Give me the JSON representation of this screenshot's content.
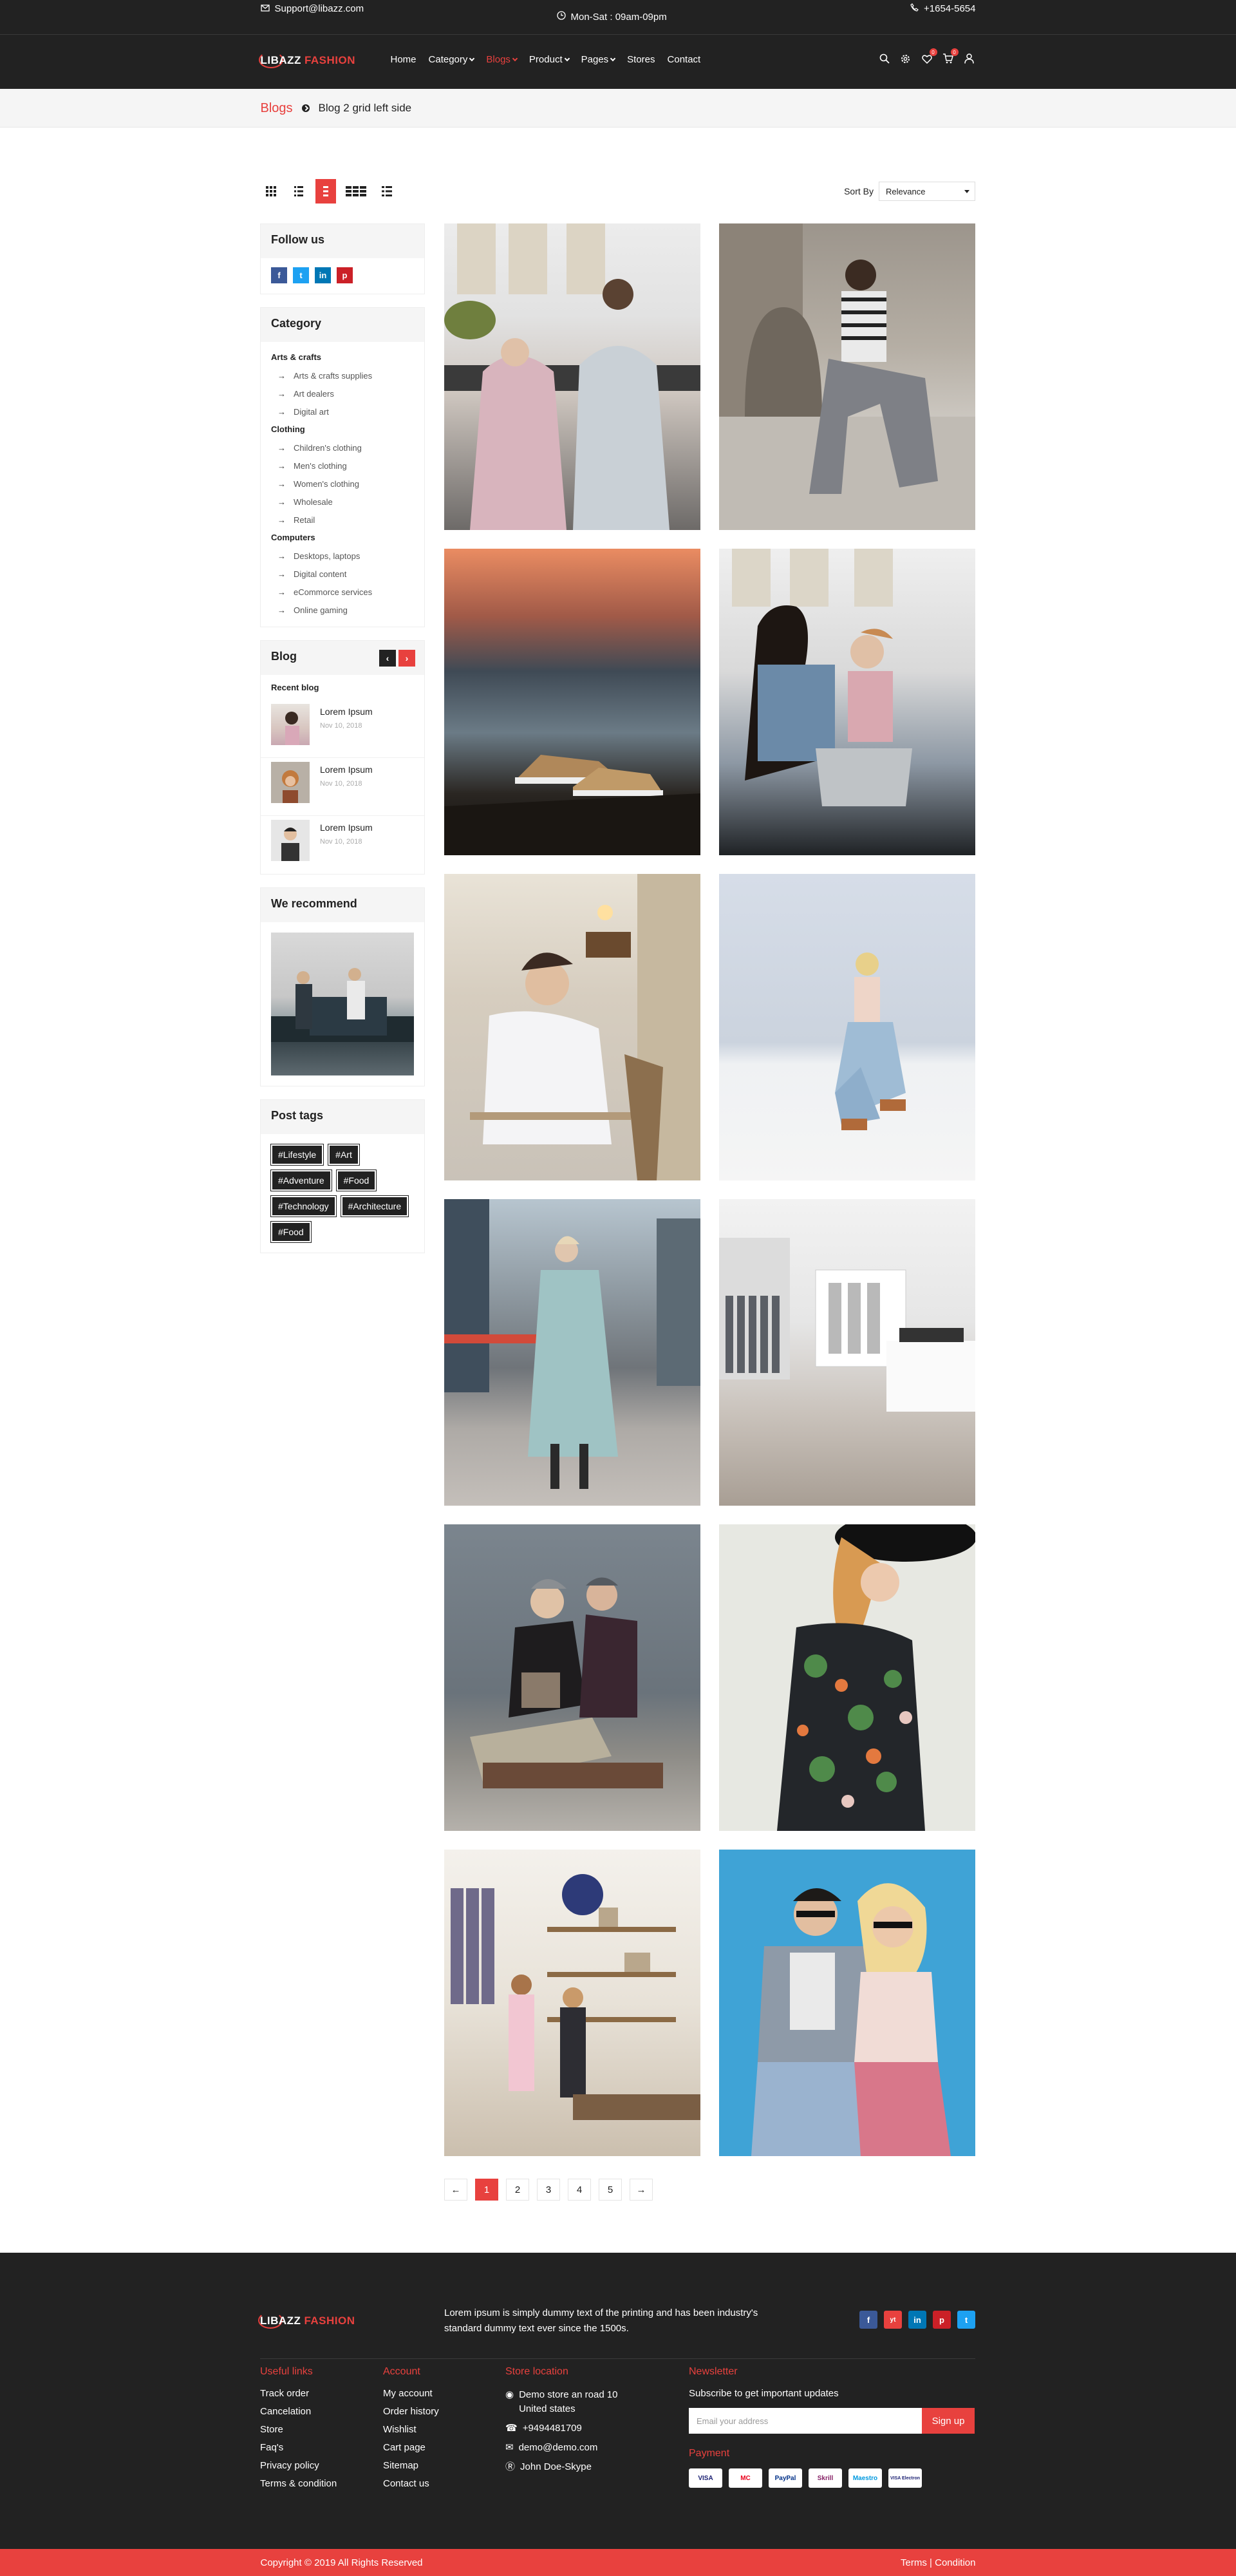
{
  "topbar": {
    "email": "Support@libazz.com",
    "hours": "Mon-Sat : 09am-09pm",
    "phone": "+1654-5654"
  },
  "header": {
    "logo_a": "LIBAZZ",
    "logo_b": "FASHION",
    "nav": [
      "Home",
      "Category",
      "Blogs",
      "Product",
      "Pages",
      "Stores",
      "Contact"
    ],
    "nav_active": "Blogs",
    "wishlist_count": "0",
    "cart_count": "0"
  },
  "breadcrumb": {
    "root": "Blogs",
    "current": "Blog 2 grid left side"
  },
  "toolbar": {
    "sort_label": "Sort By",
    "sort_value": "Relevance"
  },
  "sidebar": {
    "follow_title": "Follow us",
    "social": [
      "f",
      "t",
      "in",
      "p"
    ],
    "category_title": "Category",
    "categories": [
      {
        "group": "Arts & crafts",
        "items": [
          "Arts & crafts supplies",
          "Art dealers",
          "Digital art"
        ]
      },
      {
        "group": "Clothing",
        "items": [
          "Children's clothing",
          "Men's clothing",
          "Women's clothing",
          "Wholesale",
          "Retail"
        ]
      },
      {
        "group": "Computers",
        "items": [
          "Desktops, laptops",
          "Digital content",
          "eCommorce services",
          "Online gaming"
        ]
      }
    ],
    "blog_title": "Blog",
    "recent_label": "Recent blog",
    "recent_posts": [
      {
        "title": "Lorem Ipsum",
        "date": "Nov 10, 2018"
      },
      {
        "title": "Lorem Ipsum",
        "date": "Nov 10, 2018"
      },
      {
        "title": "Lorem Ipsum",
        "date": "Nov 10, 2018"
      }
    ],
    "recommend_title": "We recommend",
    "tags_title": "Post tags",
    "tags": [
      "#Lifestyle",
      "#Art",
      "#Adventure",
      "#Food",
      "#Technology",
      "#Architecture",
      "#Food"
    ]
  },
  "posts": [
    {
      "photo": "couple-with-blankets-kitchen"
    },
    {
      "photo": "woman-sitting-on-steps"
    },
    {
      "photo": "sneakers-on-rock-sunset"
    },
    {
      "photo": "mother-daughter-cooking"
    },
    {
      "photo": "man-in-cafe"
    },
    {
      "photo": "woman-kneeling-salt-flat"
    },
    {
      "photo": "woman-walking-street"
    },
    {
      "photo": "clothing-store-interior"
    },
    {
      "photo": "couple-on-bench"
    },
    {
      "photo": "woman-floral-dress-hat"
    },
    {
      "photo": "women-shopping-boutique"
    },
    {
      "photo": "couple-sunglasses-blue"
    }
  ],
  "pagination": {
    "prev": "←",
    "pages": [
      "1",
      "2",
      "3",
      "4",
      "5"
    ],
    "current": "1",
    "next": "→"
  },
  "footer": {
    "logo_a": "LIBAZZ",
    "logo_b": "FASHION",
    "description": "Lorem ipsum is simply dummy text of the printing and has been industry's standard dummy text ever since the 1500s.",
    "social": [
      "f",
      "yt",
      "in",
      "p",
      "t"
    ],
    "useful_title": "Useful links",
    "useful": [
      "Track order",
      "Cancelation",
      "Store",
      "Faq's",
      "Privacy policy",
      "Terms & condition"
    ],
    "account_title": "Account",
    "account": [
      "My account",
      "Order history",
      "Wishlist",
      "Cart page",
      "Sitemap",
      "Contact us"
    ],
    "location_title": "Store location",
    "address": "Demo store an road 10 United states",
    "phone": "+9494481709",
    "email": "demo@demo.com",
    "skype": "John Doe-Skype",
    "newsletter_title": "Newsletter",
    "newsletter_text": "Subscribe to get important updates",
    "newsletter_placeholder": "Email your address",
    "newsletter_button": "Sign up",
    "payment_title": "Payment",
    "payments": [
      "VISA",
      "MC",
      "PayPal",
      "Skrill",
      "Maestro",
      "VISA Electron"
    ]
  },
  "copyright": {
    "text": "Copyright © 2019 All Rights Reserved",
    "terms": "Terms | Condition"
  },
  "colors": {
    "accent": "#e8413e",
    "dark": "#222222"
  }
}
